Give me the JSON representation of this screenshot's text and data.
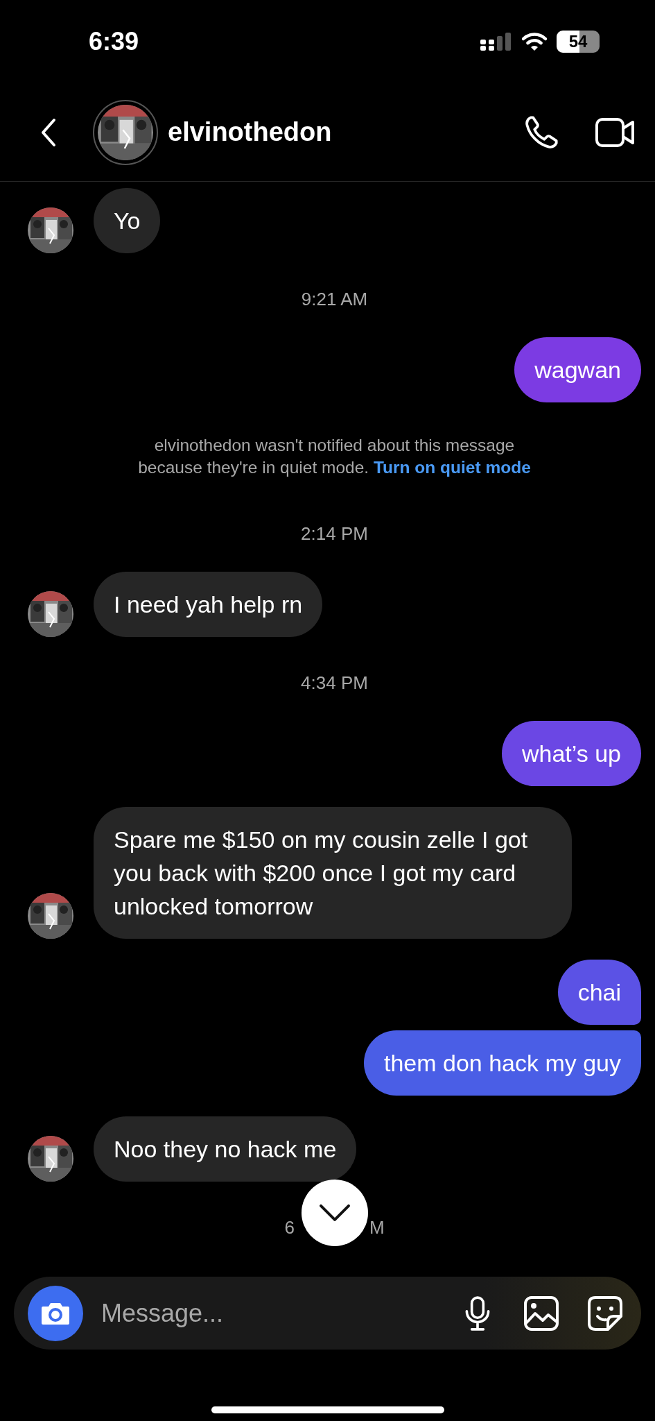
{
  "status_bar": {
    "time": "6:39",
    "battery": "54"
  },
  "header": {
    "username": "elvinothedon"
  },
  "messages": [
    {
      "kind": "incoming",
      "text": "Yo"
    },
    {
      "kind": "timestamp",
      "text": "9:21 AM"
    },
    {
      "kind": "outgoing",
      "text": "wagwan"
    },
    {
      "kind": "notice",
      "text": "elvinothedon wasn't notified about this message because they're in quiet mode.",
      "link": "Turn on quiet mode"
    },
    {
      "kind": "timestamp",
      "text": "2:14 PM"
    },
    {
      "kind": "incoming",
      "text": "I need yah help rn"
    },
    {
      "kind": "timestamp",
      "text": "4:34 PM"
    },
    {
      "kind": "outgoing",
      "text": "what’s up"
    },
    {
      "kind": "incoming",
      "text": "Spare me $150 on my cousin zelle I got  you back with $200 once I got my card unlocked tomorrow"
    },
    {
      "kind": "outgoing",
      "text": "chai"
    },
    {
      "kind": "outgoing",
      "text": "them don hack my guy"
    },
    {
      "kind": "incoming",
      "text": "Noo they no hack me"
    },
    {
      "kind": "timestamp_covered",
      "visible_start": "6",
      "visible_end": "M"
    }
  ],
  "composer": {
    "placeholder": "Message..."
  }
}
